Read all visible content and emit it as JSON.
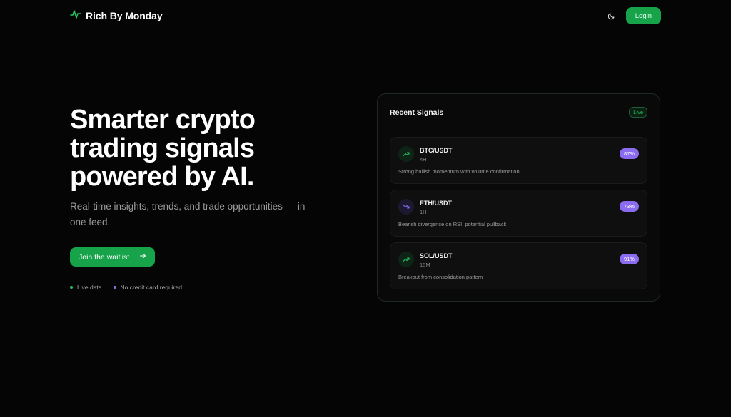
{
  "brand": {
    "name": "Rich By Monday",
    "accent": "#22c55e"
  },
  "nav": {
    "theme_icon": "moon-icon",
    "login_label": "Login"
  },
  "hero": {
    "title_line1": "Smarter crypto",
    "title_line2": "trading signals",
    "title_line3": "powered by AI.",
    "subtitle": "Real-time insights, trends, and trade opportunities — in one feed.",
    "cta_label": "Join the waitlist",
    "cta_icon": "arrow-right-icon",
    "badges": [
      {
        "label": "Live data",
        "color": "#22c55e"
      },
      {
        "label": "No credit card required",
        "color": "#8b6cf0"
      }
    ]
  },
  "signals_card": {
    "title": "Recent Signals",
    "status": "Live",
    "items": [
      {
        "pair": "BTC/USDT",
        "timeframe": "4H",
        "description": "Strong bullish momentum with volume confirmation",
        "confidence": "87%",
        "direction": "up",
        "icon": "trend-up-icon"
      },
      {
        "pair": "ETH/USDT",
        "timeframe": "1H",
        "description": "Bearish divergence on RSI, potential pullback",
        "confidence": "73%",
        "direction": "down",
        "icon": "trend-down-icon"
      },
      {
        "pair": "SOL/USDT",
        "timeframe": "15M",
        "description": "Breakout from consolidation pattern",
        "confidence": "91%",
        "direction": "up",
        "icon": "trend-up-icon"
      }
    ]
  },
  "colors": {
    "background": "#050505",
    "primary_green": "#16a34a",
    "purple": "#8b6cf0"
  }
}
